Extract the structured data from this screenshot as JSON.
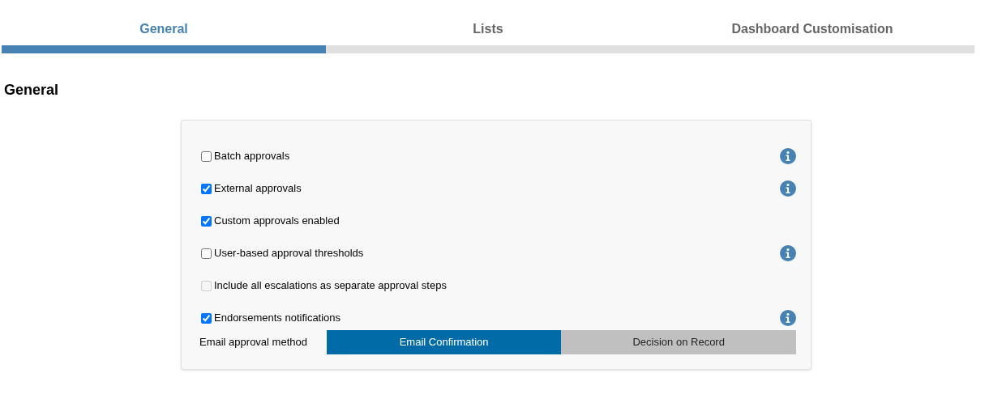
{
  "tabs": [
    {
      "label": "General",
      "selected": true
    },
    {
      "label": "Lists",
      "selected": false
    },
    {
      "label": "Dashboard Customisation",
      "selected": false
    }
  ],
  "section_title": "General",
  "settings": [
    {
      "label": "Batch approvals",
      "checked": false,
      "disabled": false,
      "info": true
    },
    {
      "label": "External approvals",
      "checked": true,
      "disabled": false,
      "info": true
    },
    {
      "label": "Custom approvals enabled",
      "checked": true,
      "disabled": false,
      "info": false
    },
    {
      "label": "User-based approval thresholds",
      "checked": false,
      "disabled": false,
      "info": true
    },
    {
      "label": "Include all escalations as separate approval steps",
      "checked": false,
      "disabled": true,
      "info": false
    },
    {
      "label": "Endorsements notifications",
      "checked": true,
      "disabled": false,
      "info": true
    }
  ],
  "email_method": {
    "label": "Email approval method",
    "options": [
      {
        "label": "Email Confirmation",
        "selected": true
      },
      {
        "label": "Decision on Record",
        "selected": false
      }
    ]
  }
}
